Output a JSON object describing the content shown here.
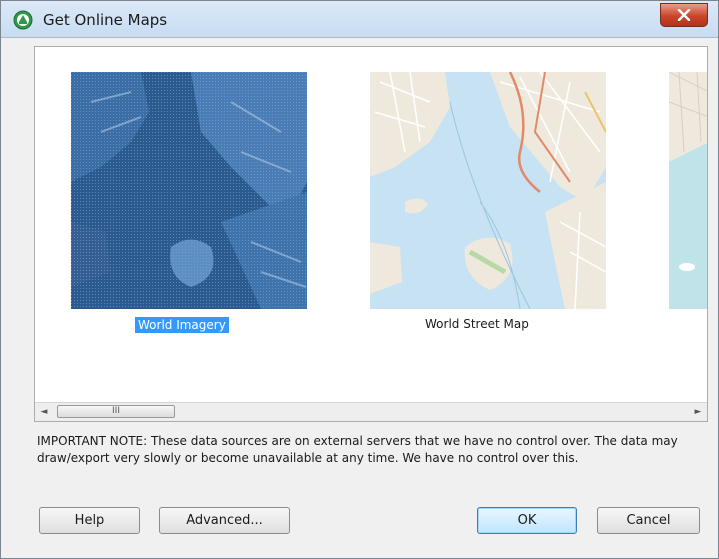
{
  "window": {
    "title": "Get Online Maps"
  },
  "maps": [
    {
      "label": "World Imagery",
      "selected": true
    },
    {
      "label": "World Street Map",
      "selected": false
    }
  ],
  "scrollbar": {
    "thumb_grip": "III",
    "left_arrow": "◄",
    "right_arrow": "►"
  },
  "note": "IMPORTANT NOTE: These data sources are on external servers that we have no control over. The data may draw/export very slowly or become unavailable at any time. We have no control over this.",
  "buttons": {
    "help": "Help",
    "advanced": "Advanced...",
    "ok": "OK",
    "cancel": "Cancel"
  },
  "colors": {
    "selection": "#3399ff",
    "water_imagery": "#2b5a8e",
    "water_street": "#c6e2f3"
  }
}
